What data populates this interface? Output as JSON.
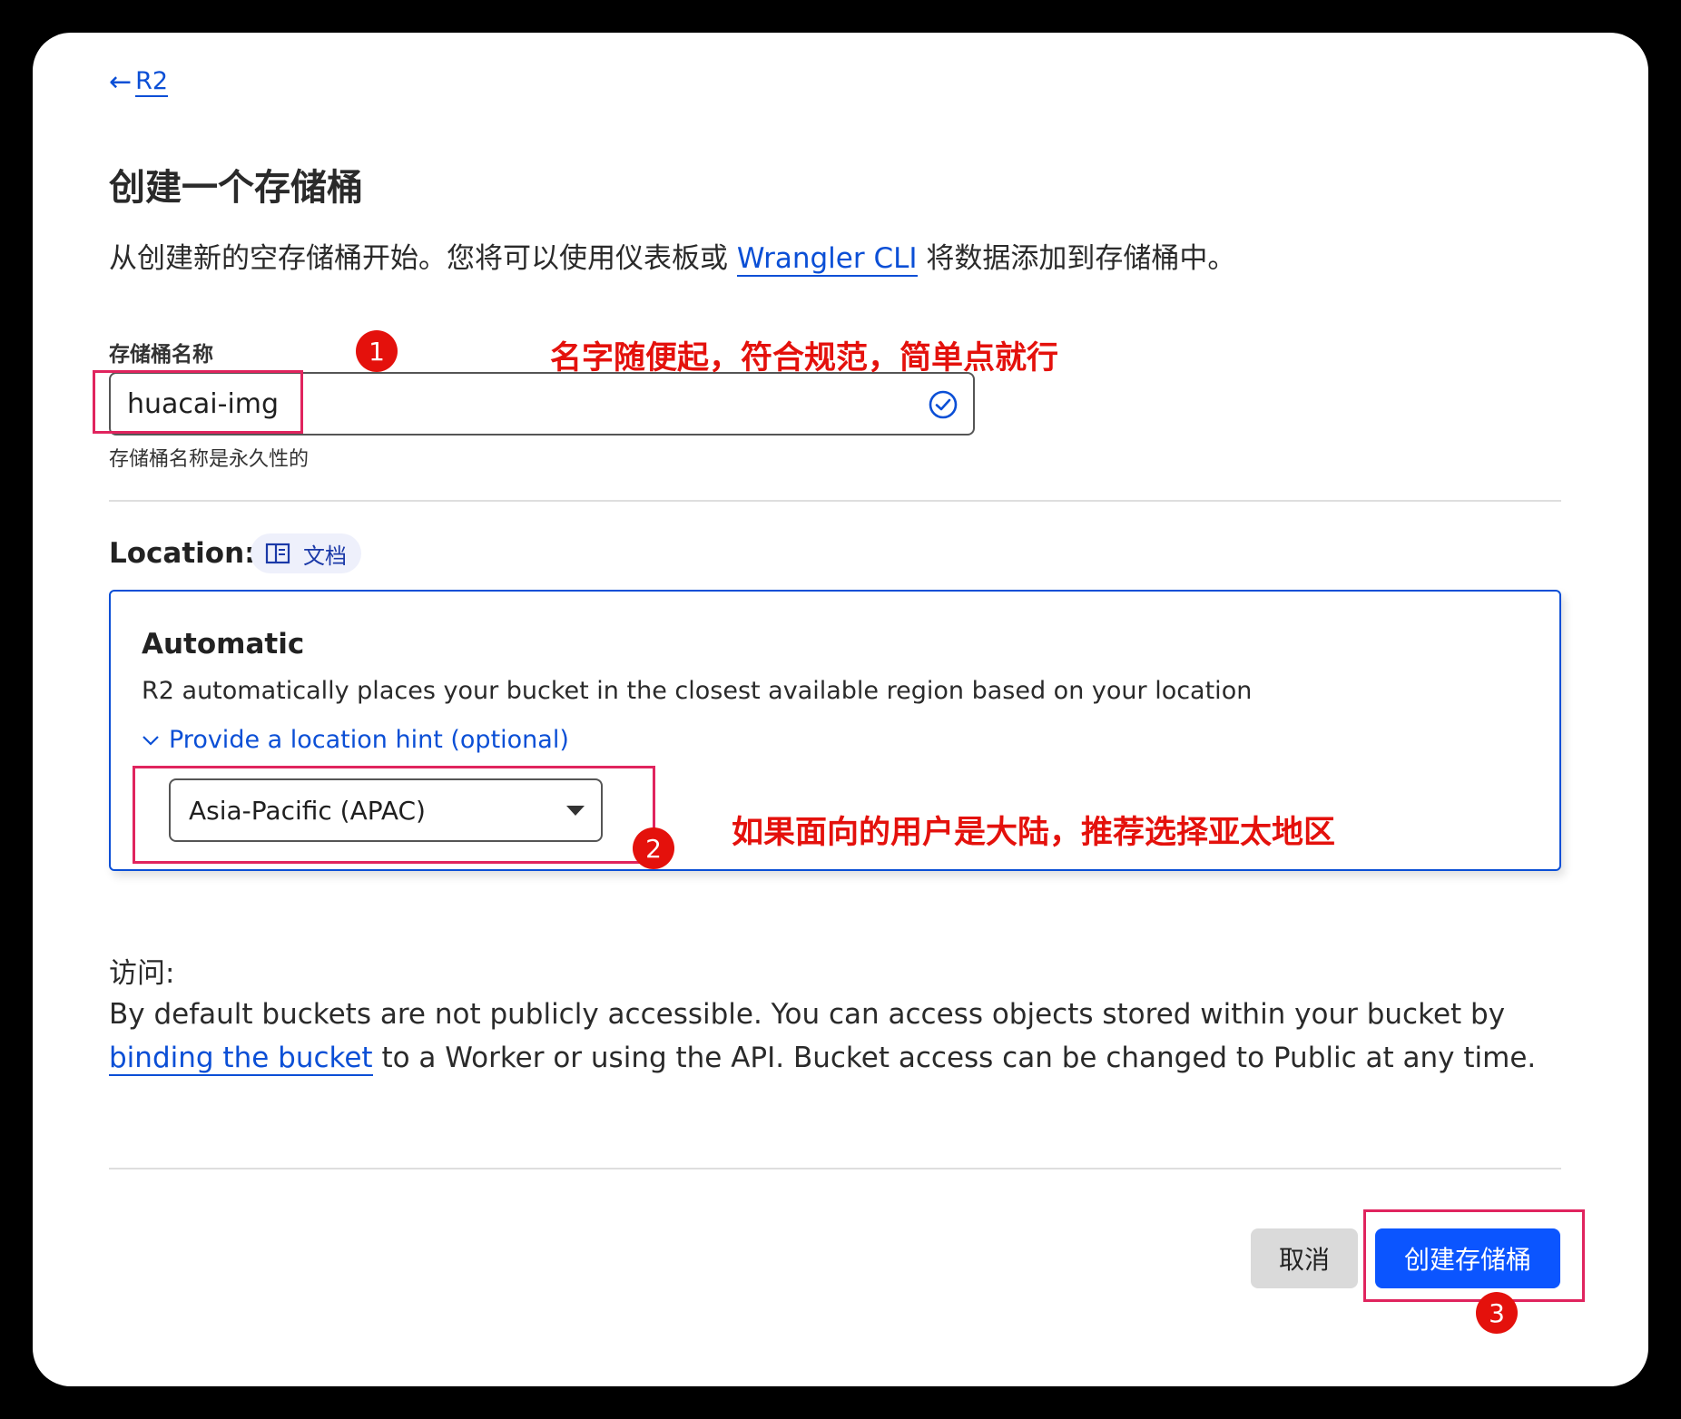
{
  "nav": {
    "back_label": "R2"
  },
  "page": {
    "title": "创建一个存储桶",
    "intro_before": "从创建新的空存储桶开始。您将可以使用仪表板或 ",
    "intro_link": "Wrangler CLI",
    "intro_after": " 将数据添加到存储桶中。"
  },
  "bucket_name": {
    "label": "存储桶名称",
    "value": "huacai-img",
    "helper": "存储桶名称是永久性的"
  },
  "location": {
    "label": "Location:",
    "doc_chip": "文档",
    "option_title": "Automatic",
    "option_desc": "R2 automatically places your bucket in the closest available region based on your location",
    "hint_toggle": "Provide a location hint (optional)",
    "hint_selected": "Asia-Pacific (APAC)"
  },
  "access": {
    "label": "访问:",
    "desc_before": "By default buckets are not publicly accessible. You can access objects stored within your bucket by ",
    "desc_link": "binding the bucket",
    "desc_after": " to a Worker or using the API. Bucket access can be changed to Public at any time."
  },
  "actions": {
    "cancel": "取消",
    "create": "创建存储桶"
  },
  "annotations": {
    "badge1": "1",
    "note1": "名字随便起，符合规范，简单点就行",
    "badge2": "2",
    "note2": "如果面向的用户是大陆，推荐选择亚太地区",
    "badge3": "3"
  },
  "colors": {
    "accent": "#0b4fd6",
    "primary_button": "#0b55ff",
    "annotation": "#e4110c"
  }
}
